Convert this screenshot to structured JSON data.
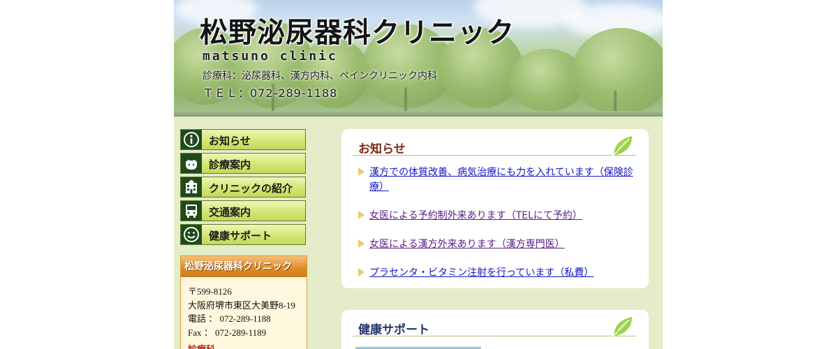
{
  "header": {
    "title": "松野泌尿器科クリニック",
    "subtitle": "matsuno clinic",
    "departments": "診療科：泌尿器科、漢方内科、ペインクリニック内科",
    "tel": "ＴＥＬ：072-289-1188"
  },
  "nav": {
    "items": [
      {
        "label": "お知らせ",
        "icon": "info-icon"
      },
      {
        "label": "診療案内",
        "icon": "doctor-icon"
      },
      {
        "label": "クリニックの紹介",
        "icon": "building-icon"
      },
      {
        "label": "交通案内",
        "icon": "bus-icon"
      },
      {
        "label": "健康サポート",
        "icon": "smile-icon"
      }
    ]
  },
  "clinic_info": {
    "title": "松野泌尿器科クリニック",
    "postal": "〒599-8126",
    "address": "大阪府堺市東区大美野8-19",
    "phone": "電話 ： 072-289-1188",
    "fax": "Fax ： 072-289-1189",
    "hours_heading": "診療科"
  },
  "news": {
    "title": "お知らせ",
    "items": [
      "漢方での体質改善、病気治療にも力を入れています（保険診療）",
      "女医による予約制外来あります（TELにて予約）",
      "女医による漢方外来あります（漢方専門医）",
      "プラセンタ・ビタミン注射を行っています（私費）"
    ]
  },
  "health": {
    "title": "健康サポート"
  },
  "colors": {
    "page_bg": "#e4ecc9",
    "nav_green": "#c3d95a",
    "nav_icon_bg": "#1f4a1c",
    "news_title": "#7b2a14",
    "health_title": "#26366e",
    "link": "#1515c8",
    "link_visited": "#5b1f8c",
    "info_header": "#e08e2a"
  }
}
